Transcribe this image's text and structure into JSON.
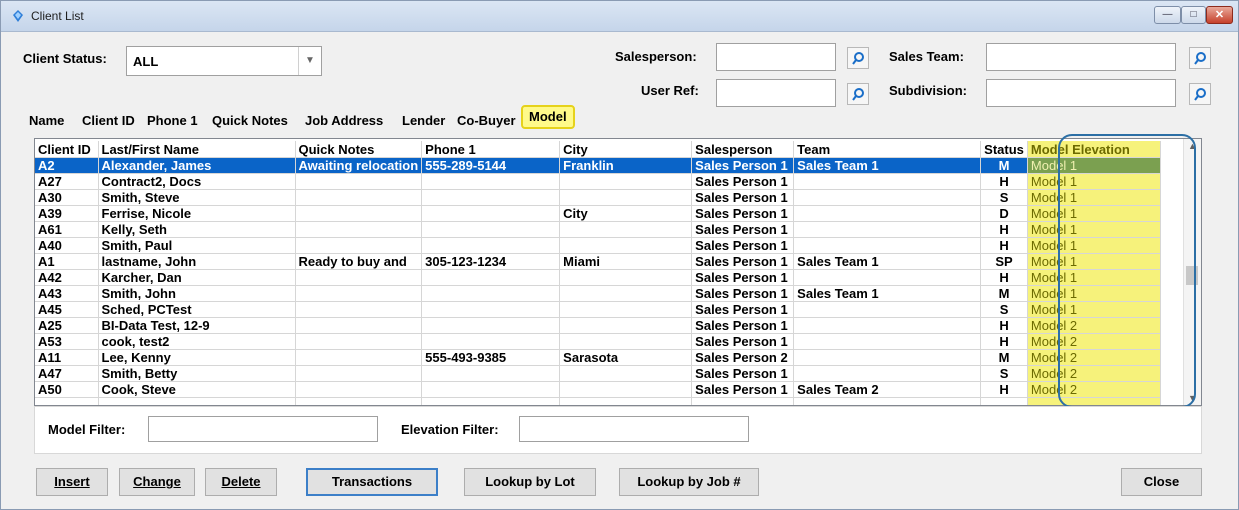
{
  "window": {
    "title": "Client List"
  },
  "titlebar_buttons": {
    "minimize": "—",
    "maximize": "□",
    "close": "✕"
  },
  "header": {
    "client_status_label": "Client Status:",
    "client_status_value": "ALL",
    "salesperson_label": "Salesperson:",
    "sales_team_label": "Sales Team:",
    "user_ref_label": "User Ref:",
    "subdivision_label": "Subdivision:"
  },
  "tabs": [
    "Name",
    "Client ID",
    "Phone 1",
    "Quick Notes",
    "Job Address",
    "Lender",
    "Co-Buyer",
    "Model"
  ],
  "grid": {
    "columns": [
      "Client ID",
      "Last/First Name",
      "Quick Notes",
      "Phone 1",
      "City",
      "Salesperson",
      "Team",
      "Status",
      "Model Elevation"
    ],
    "rows": [
      [
        "A2",
        "Alexander, James",
        "Awaiting relocation",
        "555-289-5144",
        "Franklin",
        "Sales Person 1",
        "Sales Team 1",
        "M",
        "Model 1"
      ],
      [
        "A27",
        "Contract2, Docs",
        "",
        "",
        "",
        "Sales Person 1",
        "",
        "H",
        "Model 1"
      ],
      [
        "A30",
        "Smith, Steve",
        "",
        "",
        "",
        "Sales Person 1",
        "",
        "S",
        "Model 1"
      ],
      [
        "A39",
        "Ferrise, Nicole",
        "",
        "",
        "City",
        "Sales Person 1",
        "",
        "D",
        "Model 1"
      ],
      [
        "A61",
        "Kelly, Seth",
        "",
        "",
        "",
        "Sales Person 1",
        "",
        "H",
        "Model 1"
      ],
      [
        "A40",
        "Smith, Paul",
        "",
        "",
        "",
        "Sales Person 1",
        "",
        "H",
        "Model 1"
      ],
      [
        "A1",
        "lastname, John",
        "Ready to buy and",
        "305-123-1234",
        "Miami",
        "Sales Person 1",
        "Sales Team 1",
        "SP",
        "Model 1"
      ],
      [
        "A42",
        "Karcher, Dan",
        "",
        "",
        "",
        "Sales Person 1",
        "",
        "H",
        "Model 1"
      ],
      [
        "A43",
        "Smith, John",
        "",
        "",
        "",
        "Sales Person 1",
        "Sales Team 1",
        "M",
        "Model 1"
      ],
      [
        "A45",
        "Sched, PCTest",
        "",
        "",
        "",
        "Sales Person 1",
        "",
        "S",
        "Model 1"
      ],
      [
        "A25",
        "BI-Data Test, 12-9",
        "",
        "",
        "",
        "Sales Person 1",
        "",
        "H",
        "Model 2"
      ],
      [
        "A53",
        "cook, test2",
        "",
        "",
        "",
        "Sales Person 1",
        "",
        "H",
        "Model 2"
      ],
      [
        "A11",
        "Lee, Kenny",
        "",
        "555-493-9385",
        "Sarasota",
        "Sales Person 2",
        "",
        "M",
        "Model 2"
      ],
      [
        "A47",
        "Smith, Betty",
        "",
        "",
        "",
        "Sales Person 1",
        "",
        "S",
        "Model 2"
      ],
      [
        "A50",
        "Cook, Steve",
        "",
        "",
        "",
        "Sales Person 1",
        "Sales Team 2",
        "H",
        "Model 2"
      ]
    ]
  },
  "filters": {
    "model_label": "Model Filter:",
    "elevation_label": "Elevation Filter:"
  },
  "buttons": {
    "insert": "Insert",
    "change": "Change",
    "delete": "Delete",
    "transactions": "Transactions",
    "lookup_lot": "Lookup by Lot",
    "lookup_job": "Lookup by Job #",
    "close": "Close"
  },
  "colors": {
    "selection": "#0a64c8",
    "highlight_yellow": "#f6f27b",
    "callout_border": "#2c6fa5"
  },
  "icons": {
    "lookup": "magnifier-icon",
    "app": "app-logo-icon"
  }
}
